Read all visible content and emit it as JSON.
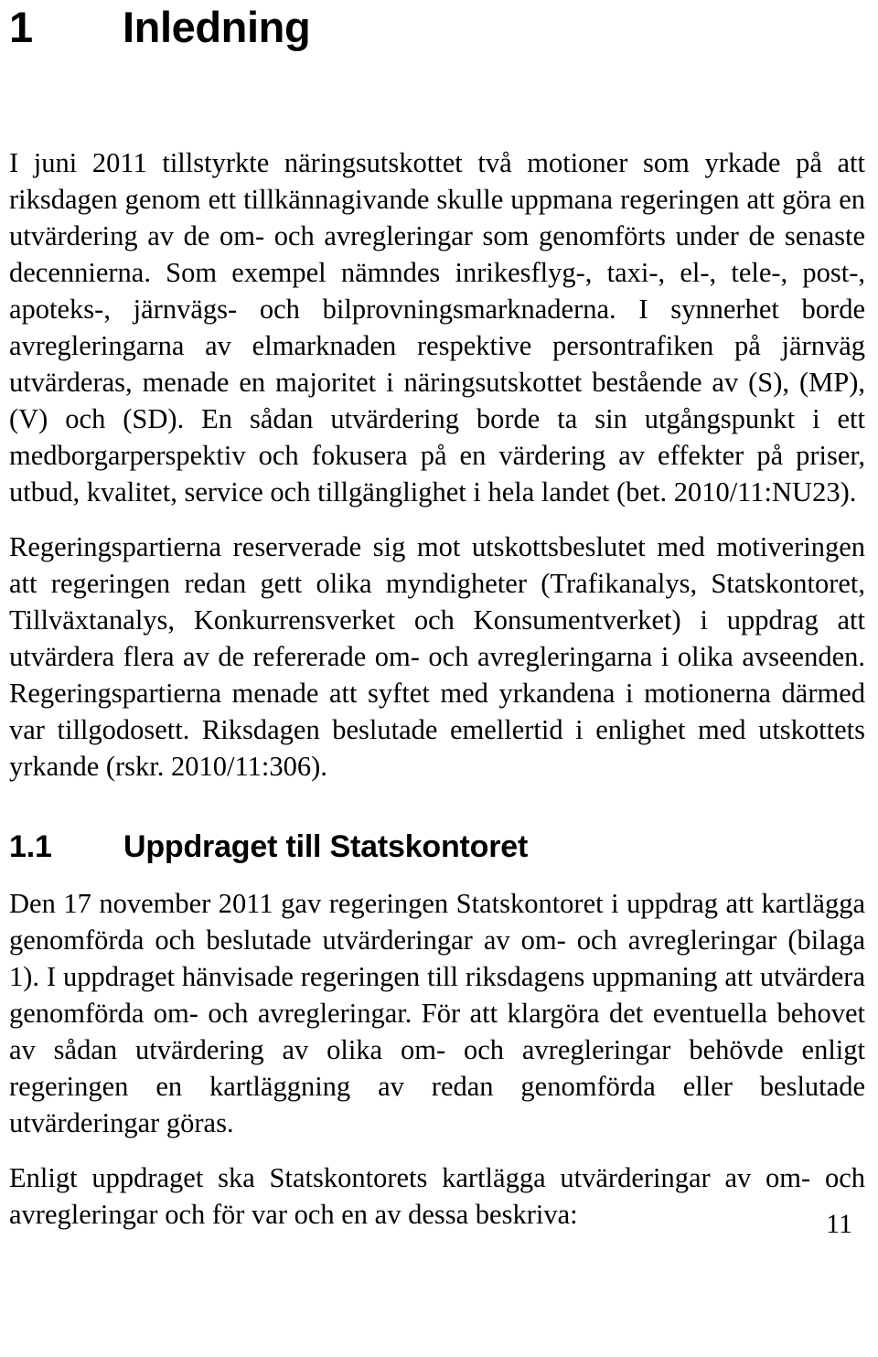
{
  "document": {
    "language": "sv",
    "page_number": "11",
    "text_color": "#000000",
    "background_color": "#ffffff"
  },
  "heading_1": {
    "number": "1",
    "title": "Inledning"
  },
  "paragraphs": {
    "intro_1": "I juni 2011 tillstyrkte näringsutskottet två motioner som yrkade på att riksdagen genom ett tillkännagivande skulle uppmana regeringen att göra en utvärdering av de om- och avregleringar som genomförts under de senaste decennierna. Som exempel nämndes inrikesflyg-, taxi-, el-, tele-, post-, apoteks-, järnvägs- och bilprovningsmarknaderna. I synnerhet borde avregleringarna av elmarknaden respektive persontrafiken på järnväg utvärderas, menade en majoritet i näringsutskottet bestående av (S), (MP), (V) och (SD). En sådan utvärdering borde ta sin utgångspunkt i ett medborgarperspektiv och fokusera på en värdering av effekter på priser, utbud, kvalitet, service och tillgänglighet i hela landet (bet. 2010/11:NU23).",
    "intro_2": "Regeringspartierna reserverade sig mot utskottsbeslutet med motiveringen att regeringen redan gett olika myndigheter (Trafikanalys, Statskontoret, Tillväxtanalys, Konkurrensverket och Konsumentverket) i uppdrag att utvärdera flera av de refererade om- och avregleringarna i olika avseenden. Regeringspartierna menade att syftet med yrkandena i motionerna därmed var tillgodosett. Riksdagen beslutade emellertid i enlighet med utskottets yrkande (rskr. 2010/11:306).",
    "section_1": "Den 17 november 2011 gav regeringen Statskontoret i uppdrag att kartlägga genomförda och beslutade utvärderingar av om- och avregleringar (bilaga 1). I uppdraget hänvisade regeringen till riksdagens uppmaning att utvärdera genomförda om- och avregleringar. För att klargöra det eventuella behovet av sådan utvärdering av olika om- och avregleringar behövde enligt regeringen en kartläggning av redan genomförda eller beslutade utvärderingar göras.",
    "section_2": "Enligt uppdraget ska Statskontorets kartlägga utvärderingar av om- och avregleringar och för var och en av dessa beskriva:"
  },
  "heading_1_1": {
    "number": "1.1",
    "title": "Uppdraget till Statskontoret"
  }
}
